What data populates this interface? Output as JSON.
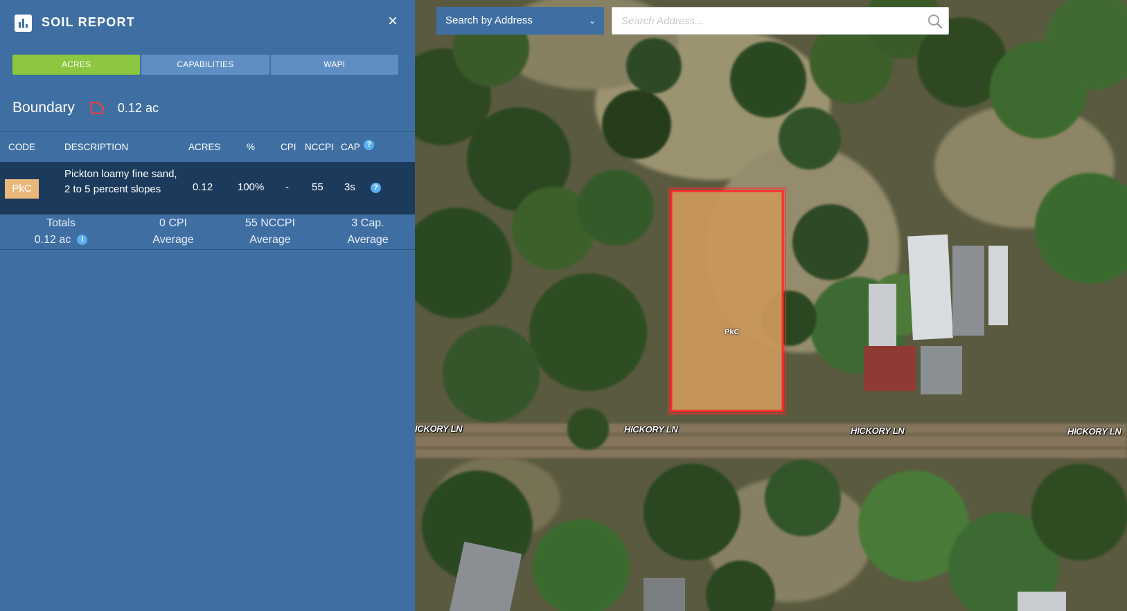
{
  "sidebar": {
    "title": "SOIL REPORT",
    "close_label": "×",
    "tabs": [
      {
        "label": "ACRES",
        "active": true
      },
      {
        "label": "CAPABILITIES",
        "active": false
      },
      {
        "label": "WAPI",
        "active": false
      }
    ],
    "boundary": {
      "label": "Boundary",
      "value": "0.12 ac",
      "icon": "boundary-polygon-icon"
    },
    "table": {
      "headers": [
        "CODE",
        "DESCRIPTION",
        "ACRES",
        "%",
        "CPI",
        "NCCPI",
        "CAP"
      ],
      "help_glyph": "?",
      "rows": [
        {
          "code": "PkC",
          "description": "Pickton loamy fine sand, 2 to 5 percent slopes",
          "acres": "0.12",
          "percent": "100%",
          "cpi": "-",
          "nccpi": "55",
          "cap": "3s"
        }
      ],
      "totals": {
        "label": "Totals",
        "acres": "0.12 ac",
        "info_glyph": "i",
        "cpi": "0 CPI",
        "cpi_sub": "Average",
        "nccpi": "55 NCCPI",
        "nccpi_sub": "Average",
        "cap": "3 Cap.",
        "cap_sub": "Average"
      }
    }
  },
  "search": {
    "mode_label": "Search by Address",
    "chevron_glyph": "⌄",
    "placeholder": "Search Address..."
  },
  "map": {
    "parcel_label": "PkC",
    "road_labels": [
      "ICKORY LN",
      "HICKORY LN",
      "HICKORY LN",
      "HICKORY LN"
    ]
  },
  "colors": {
    "sidebar_bg": "#3f6fa2",
    "active_tab": "#8dc63f",
    "inactive_tab": "#5e8ec3",
    "selected_row": "#1c3b5c",
    "soil_badge": "#e9b77a",
    "parcel_outline": "#ff2a2a",
    "parcel_fill": "#c9975a"
  }
}
